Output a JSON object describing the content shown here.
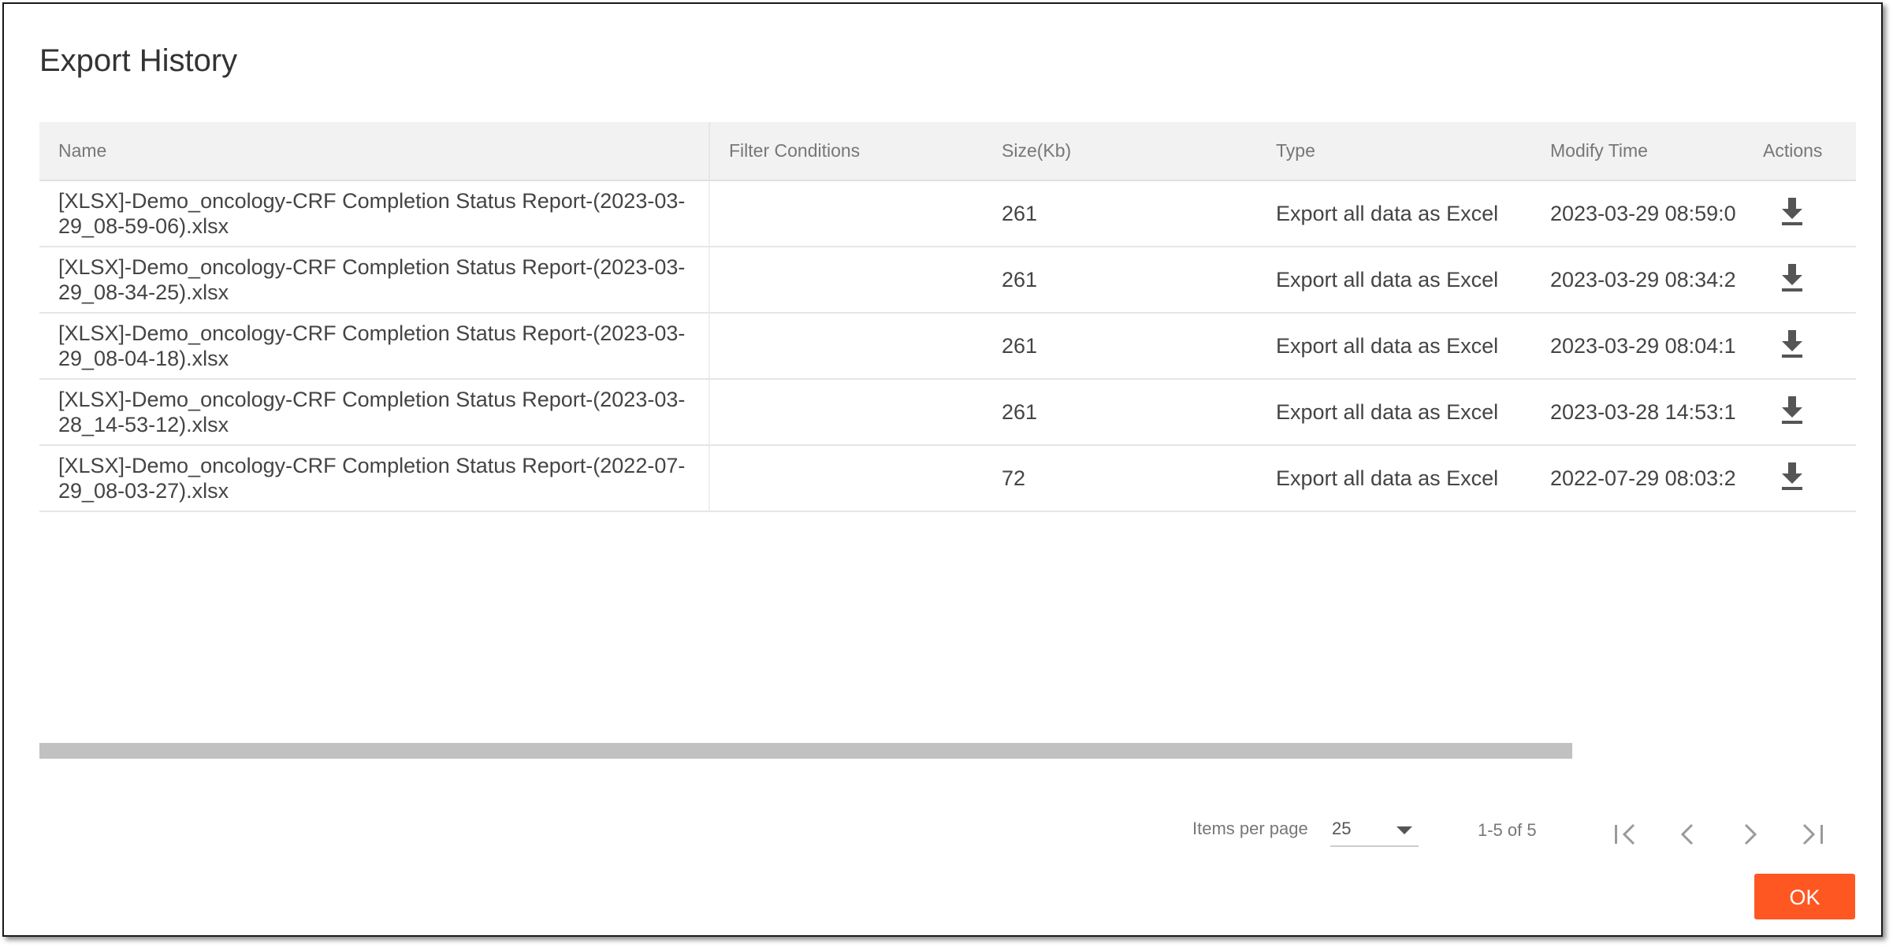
{
  "dialog": {
    "title": "Export History",
    "ok_label": "OK"
  },
  "table": {
    "headers": {
      "name": "Name",
      "filter": "Filter Conditions",
      "size": "Size(Kb)",
      "type": "Type",
      "modify": "Modify Time",
      "actions": "Actions"
    },
    "rows": [
      {
        "name": "[XLSX]-Demo_oncology-CRF Completion Status Report-(2023-03-29_08-59-06).xlsx",
        "filter": "",
        "size": "261",
        "type": "Export all data as Excel",
        "modify": "2023-03-29 08:59:0",
        "action_icon": "download-icon"
      },
      {
        "name": "[XLSX]-Demo_oncology-CRF Completion Status Report-(2023-03-29_08-34-25).xlsx",
        "filter": "",
        "size": "261",
        "type": "Export all data as Excel",
        "modify": "2023-03-29 08:34:2",
        "action_icon": "download-icon"
      },
      {
        "name": "[XLSX]-Demo_oncology-CRF Completion Status Report-(2023-03-29_08-04-18).xlsx",
        "filter": "",
        "size": "261",
        "type": "Export all data as Excel",
        "modify": "2023-03-29 08:04:1",
        "action_icon": "download-icon"
      },
      {
        "name": "[XLSX]-Demo_oncology-CRF Completion Status Report-(2023-03-28_14-53-12).xlsx",
        "filter": "",
        "size": "261",
        "type": "Export all data as Excel",
        "modify": "2023-03-28 14:53:1",
        "action_icon": "download-icon"
      },
      {
        "name": "[XLSX]-Demo_oncology-CRF Completion Status Report-(2022-07-29_08-03-27).xlsx",
        "filter": "",
        "size": "72",
        "type": "Export all data as Excel",
        "modify": "2022-07-29 08:03:2",
        "action_icon": "download-icon"
      }
    ]
  },
  "paginator": {
    "items_per_page_label": "Items per page",
    "items_per_page_value": "25",
    "range_label": "1-5 of 5",
    "icons": [
      "first-page-icon",
      "previous-page-icon",
      "next-page-icon",
      "last-page-icon"
    ]
  },
  "colors": {
    "accent": "#ff5722",
    "header_bg": "#f2f2f2",
    "scrollbar": "#c1c1c1"
  }
}
